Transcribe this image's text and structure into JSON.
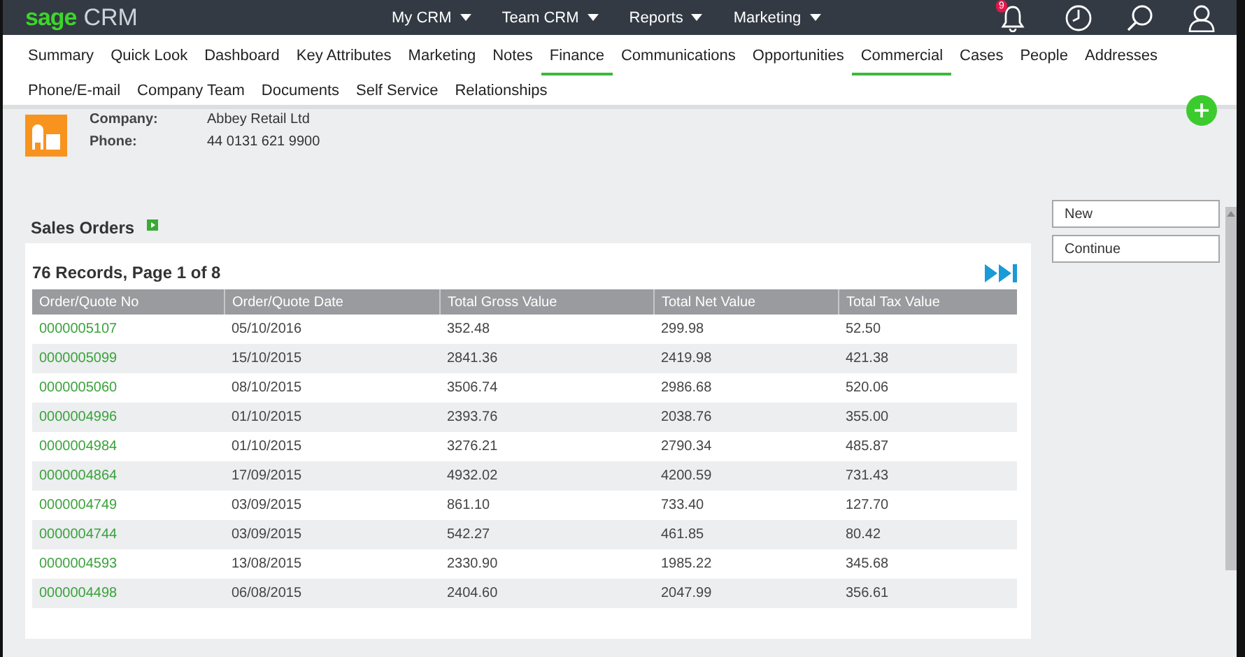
{
  "top_bar": {
    "logo_brand": "sage",
    "logo_product": "CRM",
    "menus": [
      {
        "label": "My CRM"
      },
      {
        "label": "Team CRM"
      },
      {
        "label": "Reports"
      },
      {
        "label": "Marketing"
      }
    ],
    "notification_count": "9"
  },
  "tabs": [
    {
      "label": "Summary",
      "selected": false
    },
    {
      "label": "Quick Look",
      "selected": false
    },
    {
      "label": "Dashboard",
      "selected": false
    },
    {
      "label": "Key Attributes",
      "selected": false
    },
    {
      "label": "Marketing",
      "selected": false
    },
    {
      "label": "Notes",
      "selected": false
    },
    {
      "label": "Finance",
      "selected": true
    },
    {
      "label": "Communications",
      "selected": false
    },
    {
      "label": "Opportunities",
      "selected": false
    },
    {
      "label": "Commercial",
      "selected": true
    },
    {
      "label": "Cases",
      "selected": false
    },
    {
      "label": "People",
      "selected": false
    },
    {
      "label": "Addresses",
      "selected": false
    },
    {
      "label": "Phone/E-mail",
      "selected": false
    },
    {
      "label": "Company Team",
      "selected": false
    },
    {
      "label": "Documents",
      "selected": false
    },
    {
      "label": "Self Service",
      "selected": false
    },
    {
      "label": "Relationships",
      "selected": false
    }
  ],
  "company": {
    "fields": [
      {
        "label": "Company:",
        "value": "Abbey Retail Ltd"
      },
      {
        "label": "Phone:",
        "value": "44 0131 621 9900"
      }
    ]
  },
  "sales_orders": {
    "title": "Sales Orders",
    "records": "76 Records, Page 1 of 8",
    "columns": [
      "Order/Quote No",
      "Order/Quote Date",
      "Total Gross Value",
      "Total Net Value",
      "Total Tax Value"
    ],
    "rows": [
      [
        "0000005107",
        "05/10/2016",
        "352.48",
        "299.98",
        "52.50"
      ],
      [
        "0000005099",
        "15/10/2015",
        "2841.36",
        "2419.98",
        "421.38"
      ],
      [
        "0000005060",
        "08/10/2015",
        "3506.74",
        "2986.68",
        "520.06"
      ],
      [
        "0000004996",
        "01/10/2015",
        "2393.76",
        "2038.76",
        "355.00"
      ],
      [
        "0000004984",
        "01/10/2015",
        "3276.21",
        "2790.34",
        "485.87"
      ],
      [
        "0000004864",
        "17/09/2015",
        "4932.02",
        "4200.59",
        "731.43"
      ],
      [
        "0000004749",
        "03/09/2015",
        "861.10",
        "733.40",
        "127.70"
      ],
      [
        "0000004744",
        "03/09/2015",
        "542.27",
        "461.85",
        "80.42"
      ],
      [
        "0000004593",
        "13/08/2015",
        "2330.90",
        "1985.22",
        "345.68"
      ],
      [
        "0000004498",
        "06/08/2015",
        "2404.60",
        "2047.99",
        "356.61"
      ]
    ]
  },
  "actions": [
    {
      "label": "New"
    },
    {
      "label": "Continue"
    }
  ]
}
